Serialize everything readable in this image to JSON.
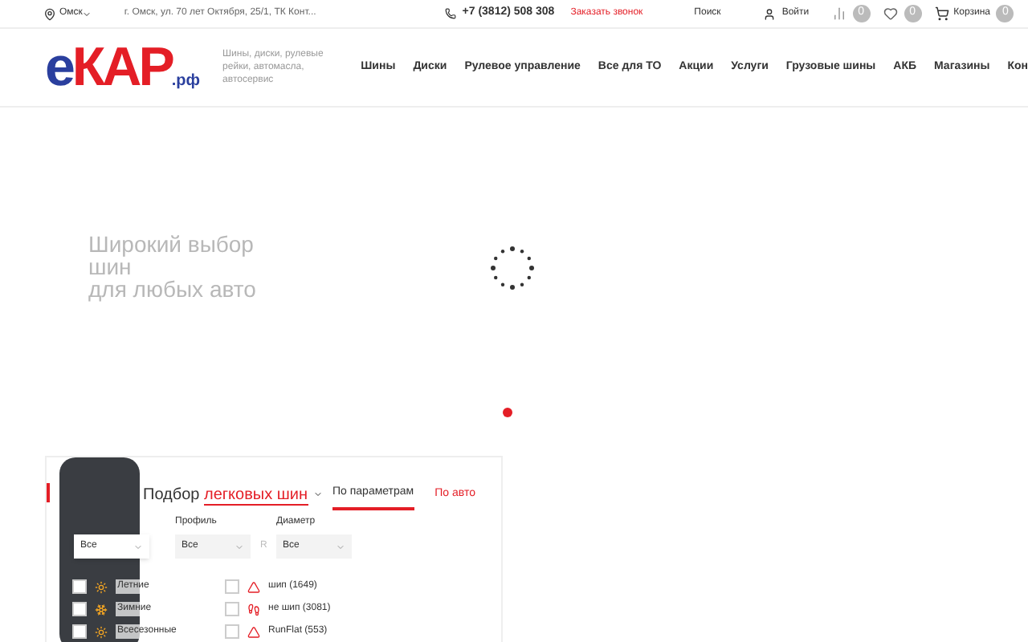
{
  "topbar": {
    "city": "Омск",
    "address": "г. Омск, ул. 70 лет Октября, 25/1, ТК Конт...",
    "phone": "+7 (3812) 508 308",
    "callback": "Заказать звонок",
    "search": "Поиск",
    "login": "Войти",
    "compare_count": "0",
    "favorites_count": "0",
    "cart": "Корзина",
    "cart_count": "0"
  },
  "header": {
    "logo_main": "еКАР",
    "logo_suffix": ".рф",
    "tagline": "Шины, диски, рулевые рейки, автомасла, автосервис",
    "nav": [
      "Шины",
      "Диски",
      "Рулевое управление",
      "Все для ТО",
      "Акции",
      "Услуги",
      "Грузовые шины",
      "АКБ",
      "Магазины",
      "Кон"
    ]
  },
  "hero": {
    "title_lines": [
      "Широкий выбор",
      "шин",
      "для любых авто"
    ],
    "slides": [
      {
        "selected": true
      }
    ]
  },
  "filter": {
    "title": "Подбор",
    "title_accent": "легковых шин",
    "tabs": [
      {
        "label": "По параметрам",
        "selected": true
      },
      {
        "label": "По авто",
        "selected": false
      }
    ],
    "selects": [
      {
        "label": "Профиль",
        "value": "Все"
      },
      {
        "label": "Диаметр",
        "value": "Все"
      }
    ],
    "width_value": "Все",
    "r_sep": "R",
    "seasons": [
      {
        "label": "Летние",
        "checked": false
      },
      {
        "label": "Зимние",
        "checked": false
      },
      {
        "label": "Всесезонные",
        "checked": false
      }
    ],
    "options": [
      {
        "label": "шип (1649)",
        "checked": false
      },
      {
        "label": "не шип (3081)",
        "checked": false
      },
      {
        "label": "RunFlat (553)",
        "checked": false
      }
    ]
  }
}
